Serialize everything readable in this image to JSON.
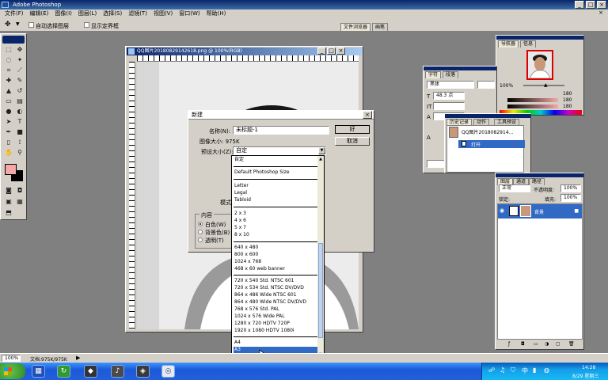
{
  "app": {
    "title": "Adobe Photoshop"
  },
  "menu": [
    "文件(F)",
    "编辑(E)",
    "图像(I)",
    "图层(L)",
    "选择(S)",
    "滤镜(T)",
    "视图(V)",
    "窗口(W)",
    "帮助(H)"
  ],
  "options": {
    "auto_select": "自动选择图层",
    "show_bounds": "显示定界框"
  },
  "top_tabs": [
    "文件浏览器",
    "画笔"
  ],
  "document": {
    "title": "QQ图片20180829142618.png @ 100%(RGB)"
  },
  "dialog": {
    "title": "新建",
    "name_label": "名称(N):",
    "name_value": "未标题-1",
    "size_label": "图像大小: 975K",
    "preset_label": "预设大小(Z):",
    "preset_value": "自定",
    "mode_label": "模式(M):",
    "ok_label": "好",
    "cancel_label": "取消",
    "contents_label": "内容",
    "radio_white": "白色(W)",
    "radio_bg": "背景色(B)",
    "radio_transparent": "透明(T)"
  },
  "preset_list": [
    "自定",
    "Default Photoshop Size",
    "Letter",
    "Legal",
    "Tabloid",
    "2 x 3",
    "4 x 6",
    "5 x 7",
    "8 x 10",
    "640 x 480",
    "800 x 600",
    "1024 x 768",
    "468 x 60 web banner",
    "720 x 540 Std. NTSC 601",
    "720 x 534 Std. NTSC DV/DVD",
    "864 x 486 Wide NTSC 601",
    "864 x 480 Wide NTSC DV/DVD",
    "768 x 576 Std. PAL",
    "1024 x 576 Wide PAL",
    "1280 x 720 HDTV 720P",
    "1920 x 1080 HDTV 1080i",
    "A4",
    "A3"
  ],
  "navigator": {
    "tabs": [
      "导航器",
      "信息"
    ],
    "zoom": "100%"
  },
  "character": {
    "tabs": [
      "字符",
      "段落"
    ],
    "font": "黑体",
    "size": "48.3 点"
  },
  "color_values": {
    "r": "180",
    "g": "180",
    "b": "180"
  },
  "history": {
    "tabs": [
      "历史记录",
      "动作",
      "工具预设"
    ],
    "snapshot": "QQ图片2018082914...",
    "step": "打开"
  },
  "layers": {
    "tabs": [
      "图层",
      "通道",
      "路径"
    ],
    "mode": "正常",
    "opacity_label": "不透明度:",
    "opacity": "100%",
    "lock_label": "锁定:",
    "fill_label": "填充:",
    "fill": "100%",
    "layer_name": "背景"
  },
  "status": {
    "zoom": "100%",
    "doc": "文档:975K/975K"
  },
  "tray": {
    "time": "14:28",
    "date": "8/29 星期三"
  },
  "colors": {
    "accent": "#316ac5",
    "foreground": "#f4a8a8",
    "background_swatch": "#000000"
  },
  "icons": [
    "move-icon",
    "marquee-icon",
    "lasso-icon",
    "magic-wand-icon",
    "crop-icon",
    "brush-icon",
    "stamp-icon",
    "eraser-icon",
    "gradient-icon",
    "pen-icon",
    "type-icon",
    "hand-icon",
    "zoom-icon",
    "eye-icon"
  ]
}
